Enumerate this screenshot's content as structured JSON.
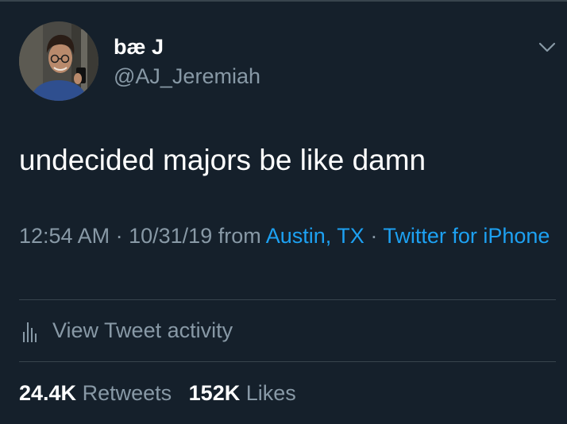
{
  "colors": {
    "background": "#15202b",
    "primary_text": "#ffffff",
    "secondary_text": "#8899a6",
    "link": "#1da1f2",
    "divider": "#38444d"
  },
  "author": {
    "display_name": "bæ J",
    "handle": "@AJ_Jeremiah",
    "avatar_icon": "profile-photo"
  },
  "tweet": {
    "text": "undecided majors be like damn",
    "time": "12:54 AM",
    "date": "10/31/19",
    "from_label": "from",
    "location": "Austin, TX",
    "separator": "·",
    "source": "Twitter for iPhone"
  },
  "activity": {
    "icon": "bar-chart-icon",
    "label": "View Tweet activity"
  },
  "stats": {
    "retweets_count": "24.4K",
    "retweets_label": "Retweets",
    "likes_count": "152K",
    "likes_label": "Likes"
  },
  "menu": {
    "icon": "chevron-down-icon"
  }
}
